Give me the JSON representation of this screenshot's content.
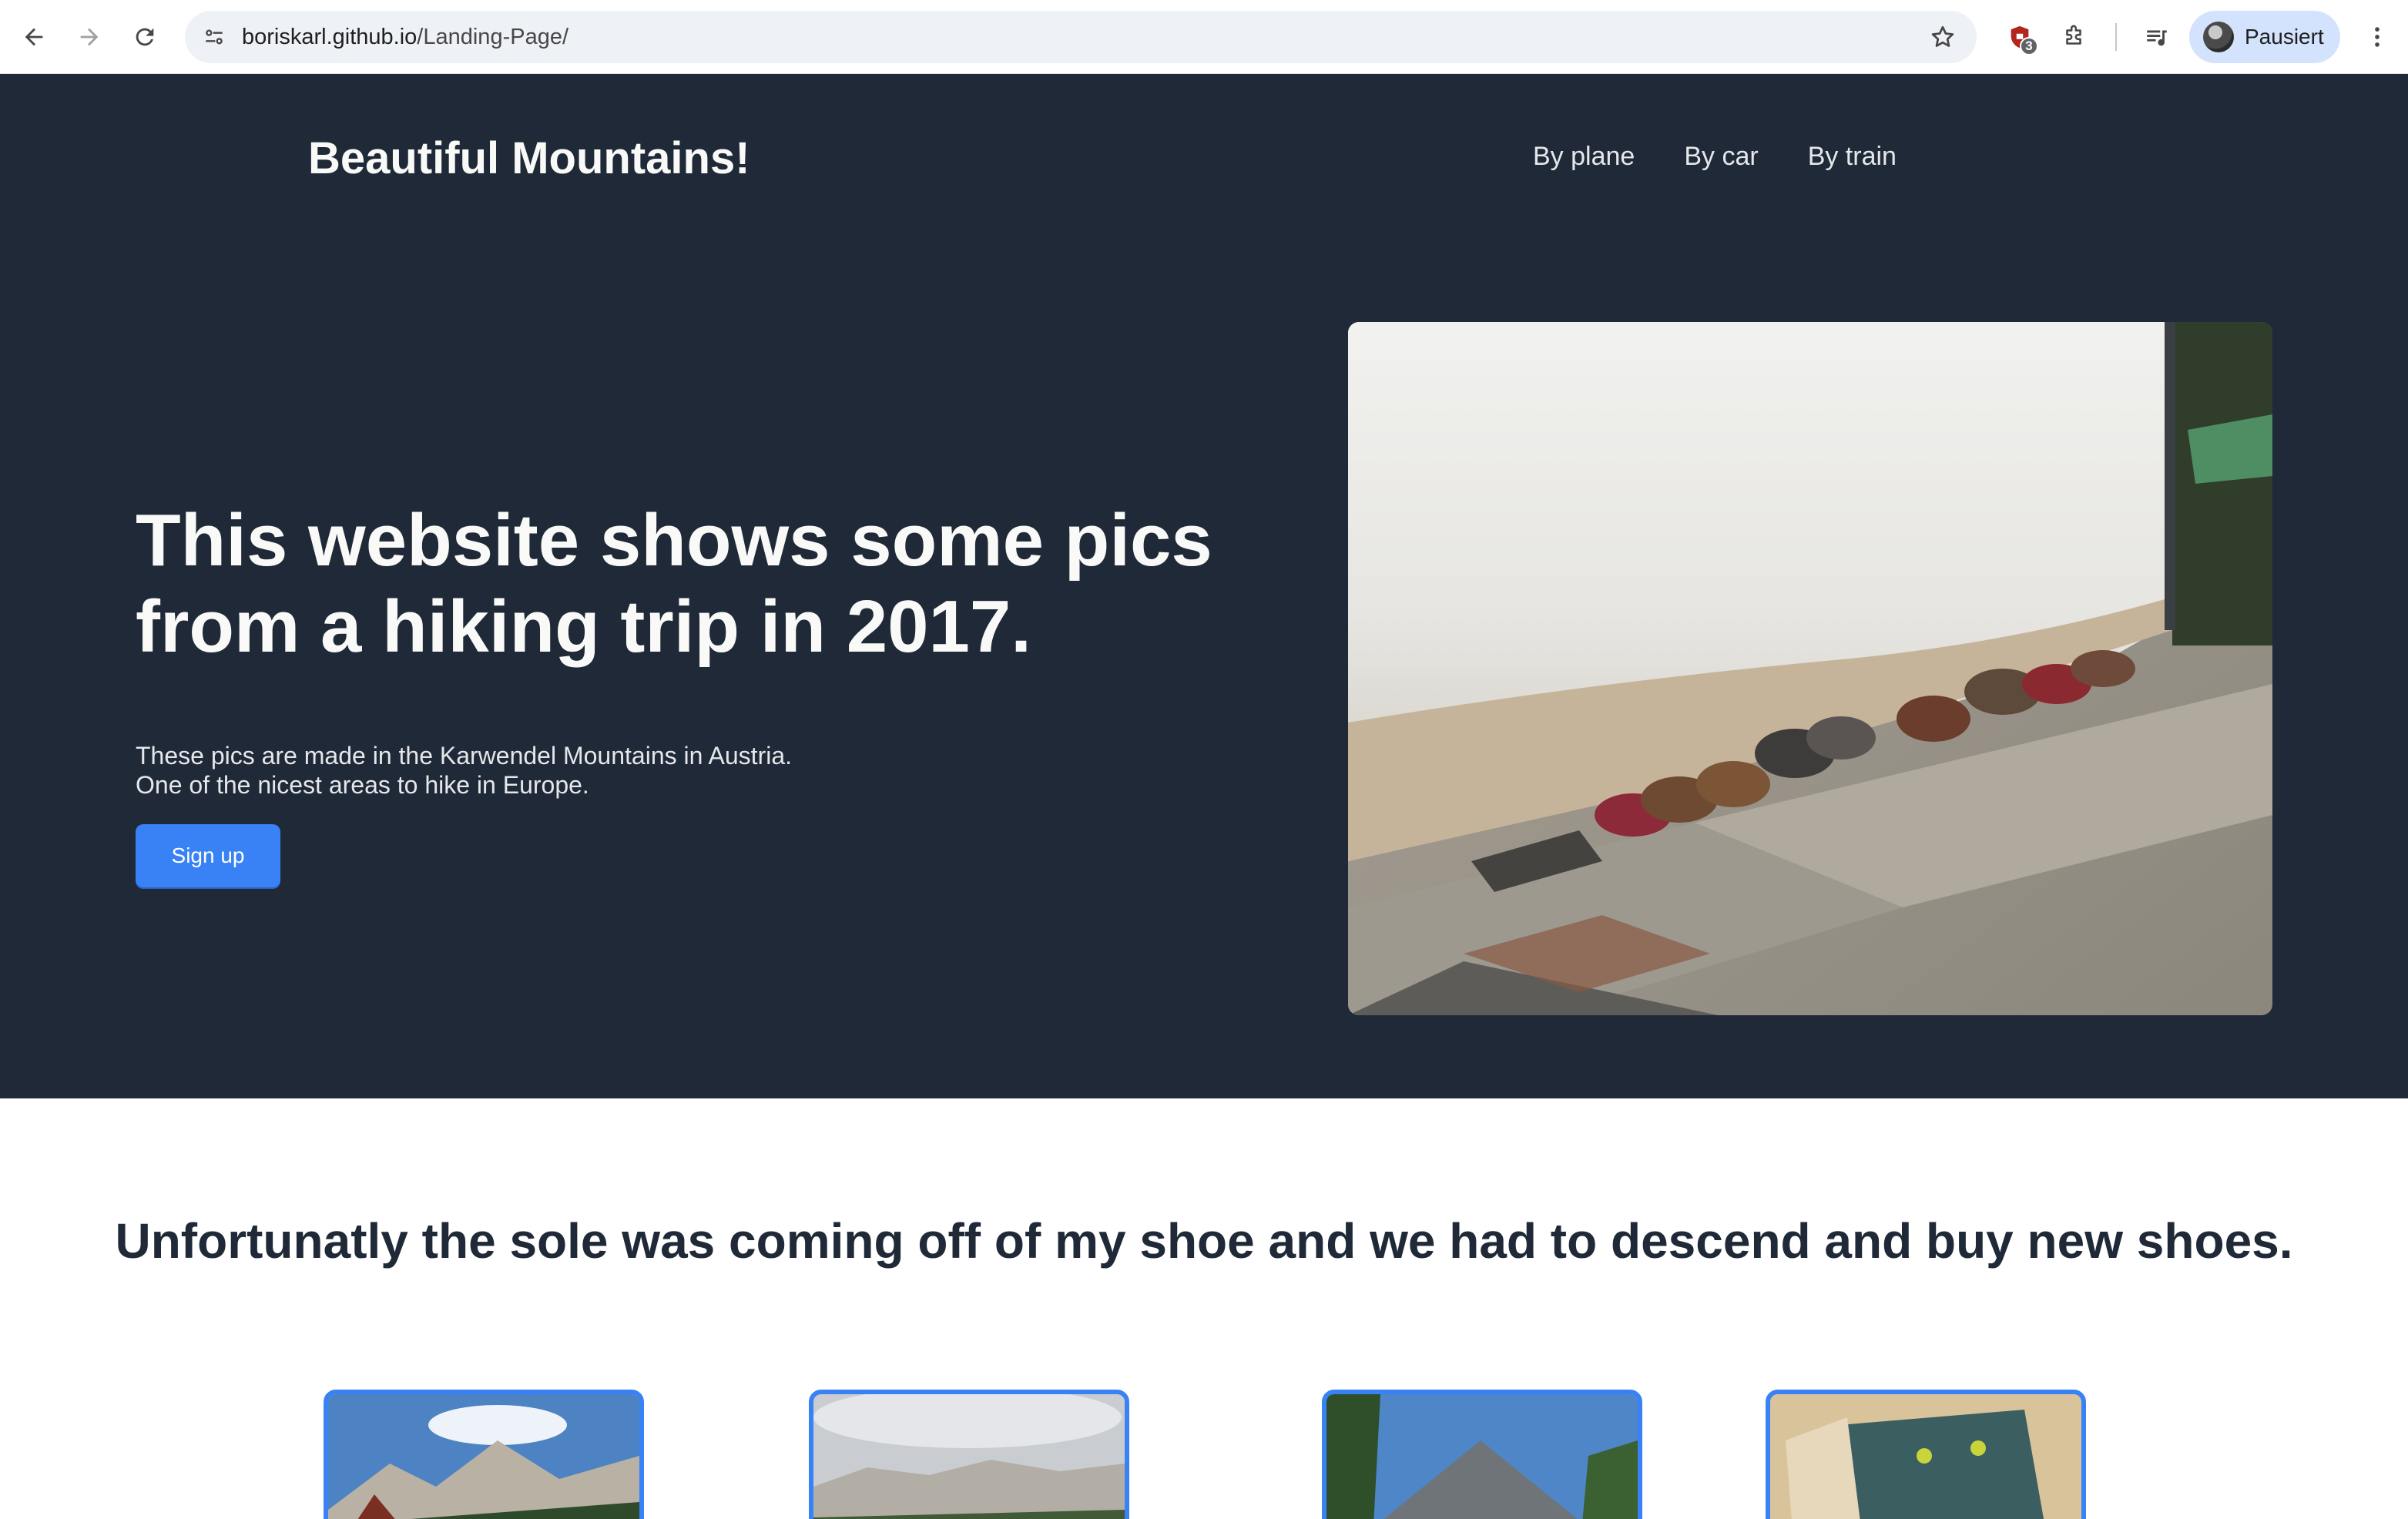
{
  "browser": {
    "url_host": "boriskarl.github.io",
    "url_path": "/Landing-Page/",
    "extension_badge": "3",
    "profile_label": "Pausiert"
  },
  "header": {
    "brand": "Beautiful Mountains!",
    "nav": [
      "By plane",
      "By car",
      "By train"
    ]
  },
  "hero": {
    "title": "This website shows some pics from a hiking trip in 2017.",
    "text_line1": "These pics are made in the Karwendel Mountains in Austria.",
    "text_line2": "One of the nicest areas to hike in Europe.",
    "button": "Sign up"
  },
  "info": {
    "title": "Unfortunatly the sole was coming off of my shoe and we had to descend and buy new shoes."
  },
  "colors": {
    "hero_bg": "#1f2937",
    "accent": "#3882f6",
    "heading_dark": "#1f2937"
  }
}
